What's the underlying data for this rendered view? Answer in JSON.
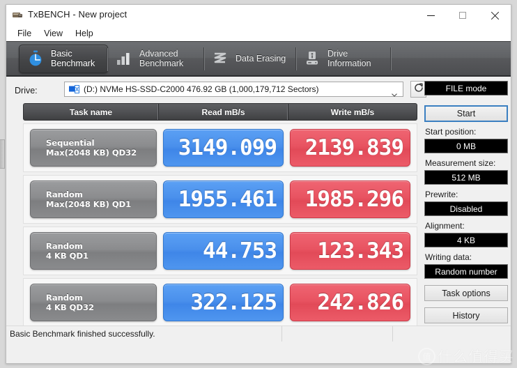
{
  "window": {
    "title": "TxBENCH - New project",
    "icon": "app-icon",
    "controls": {
      "minimize": "minimize",
      "maximize": "maximize",
      "close": "close"
    }
  },
  "menubar": {
    "items": [
      "File",
      "View",
      "Help"
    ]
  },
  "tabs": [
    {
      "label": "Basic\nBenchmark",
      "icon": "stopwatch-icon",
      "active": true
    },
    {
      "label": "Advanced\nBenchmark",
      "icon": "bar-chart-icon",
      "active": false
    },
    {
      "label": "Data Erasing",
      "icon": "shredder-icon",
      "active": false
    },
    {
      "label": "Drive\nInformation",
      "icon": "hard-drive-icon",
      "active": false
    }
  ],
  "drive": {
    "label": "Drive:",
    "selected": "(D:) NVMe HS-SSD-C2000  476.92 GB (1,000,179,712 Sectors)",
    "icon": "drive-icon",
    "dropdown_icon": "chevron-down-icon",
    "refresh_icon": "refresh-icon"
  },
  "table": {
    "headers": [
      "Task name",
      "Read mB/s",
      "Write mB/s"
    ],
    "rows": [
      {
        "task": "Sequential\nMax(2048 KB) QD32",
        "read": "3149.099",
        "write": "2139.839"
      },
      {
        "task": "Random\nMax(2048 KB) QD1",
        "read": "1955.461",
        "write": "1985.296"
      },
      {
        "task": "Random\n4 KB QD1",
        "read": "44.753",
        "write": "123.343"
      },
      {
        "task": "Random\n4 KB QD32",
        "read": "322.125",
        "write": "242.826"
      }
    ]
  },
  "sidebar": {
    "mode": "FILE mode",
    "start_button": "Start",
    "fields": [
      {
        "label": "Start position:",
        "value": "0 MB"
      },
      {
        "label": "Measurement size:",
        "value": "512 MB"
      },
      {
        "label": "Prewrite:",
        "value": "Disabled"
      },
      {
        "label": "Alignment:",
        "value": "4 KB"
      },
      {
        "label": "Writing data:",
        "value": "Random number"
      }
    ],
    "task_options_button": "Task options",
    "history_button": "History"
  },
  "statusbar": {
    "message": "Basic Benchmark finished successfully.",
    "segment2": "",
    "segment3": ""
  },
  "watermark": {
    "mark": "值",
    "text": "什么值得买"
  },
  "colors": {
    "read_bar": "#4a90ec",
    "write_bar": "#e85361",
    "task_bar": "#8b8c8e",
    "tabstrip": "#606265",
    "accent": "#3a7fc1",
    "field_bg": "#000000"
  }
}
